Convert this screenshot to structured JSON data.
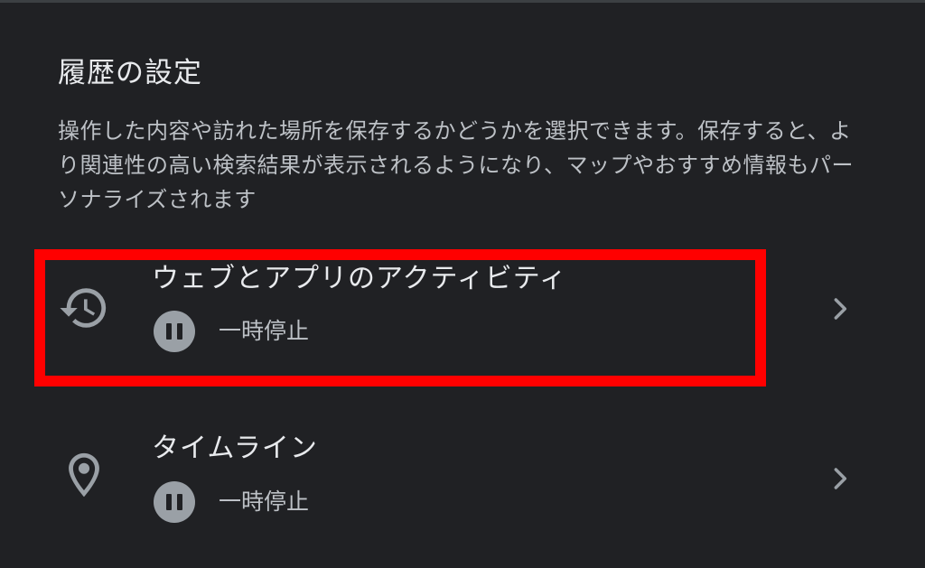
{
  "section": {
    "title": "履歴の設定",
    "description": "操作した内容や訪れた場所を保存するかどうかを選択できます。保存すると、より関連性の高い検索結果が表示されるようになり、マップやおすすめ情報もパーソナライズされます"
  },
  "settings": [
    {
      "title": "ウェブとアプリのアクティビティ",
      "status": "一時停止",
      "icon": "history-icon"
    },
    {
      "title": "タイムライン",
      "status": "一時停止",
      "icon": "location-pin-icon"
    }
  ],
  "colors": {
    "background": "#202124",
    "highlight": "#ff0000",
    "icon": "#9aa0a6"
  }
}
